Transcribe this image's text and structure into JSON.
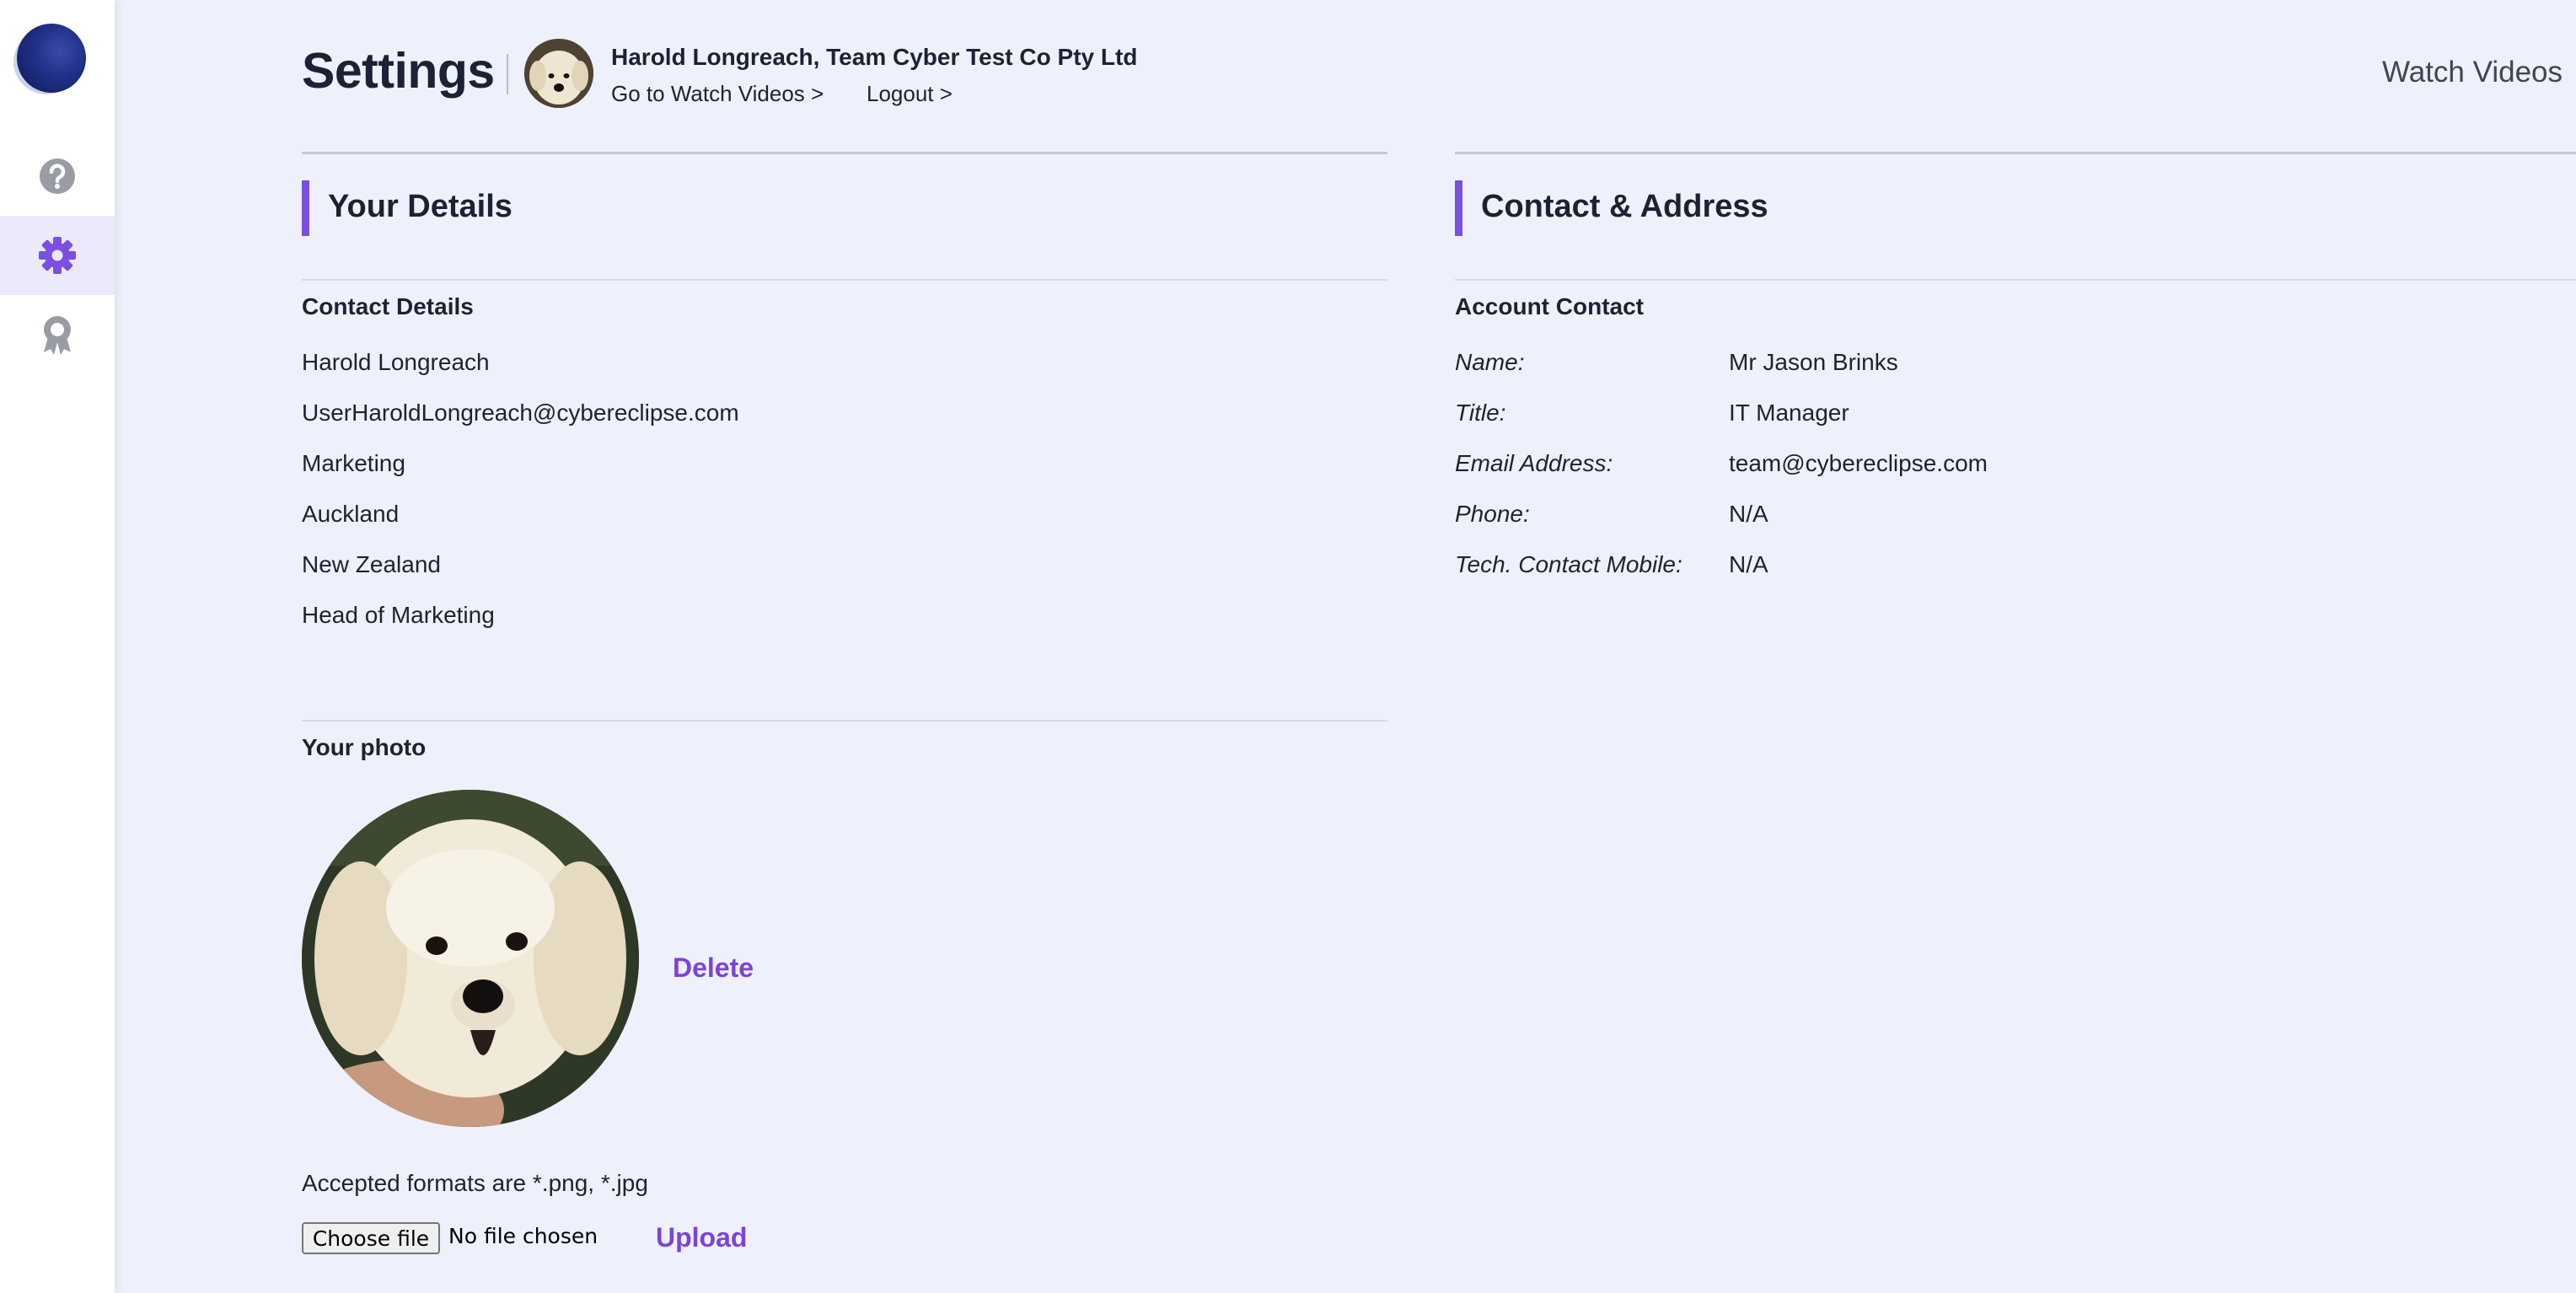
{
  "sidebar": {
    "logo_icon": "globe-logo",
    "items": [
      {
        "icon": "help-icon",
        "active": false
      },
      {
        "icon": "gear-icon",
        "active": true
      },
      {
        "icon": "award-icon",
        "active": false
      }
    ]
  },
  "header": {
    "title": "Settings",
    "user_line": "Harold Longreach, Team Cyber Test Co Pty Ltd",
    "go_to_videos": "Go to Watch Videos >",
    "logout": "Logout >",
    "watch_videos": "Watch Videos"
  },
  "your_details": {
    "title": "Your Details",
    "contact_heading": "Contact Details",
    "rows": [
      "Harold Longreach",
      "UserHaroldLongreach@cybereclipse.com",
      "Marketing",
      "Auckland",
      "New Zealand",
      "Head of Marketing"
    ],
    "photo_heading": "Your photo",
    "delete_label": "Delete",
    "formats_note": "Accepted formats are *.png, *.jpg",
    "choose_file": "Choose file",
    "no_file": "No file chosen",
    "upload_label": "Upload"
  },
  "contact_address": {
    "title": "Contact & Address",
    "heading": "Account Contact",
    "rows": [
      {
        "label": "Name:",
        "value": "Mr Jason Brinks"
      },
      {
        "label": "Title:",
        "value": "IT Manager"
      },
      {
        "label": "Email Address:",
        "value": "team@cybereclipse.com"
      },
      {
        "label": "Phone:",
        "value": "N/A"
      },
      {
        "label": "Tech. Contact Mobile:",
        "value": "N/A"
      }
    ]
  },
  "colors": {
    "accent": "#7b4fe0",
    "link": "#7b44d8",
    "background": "#eef1fb"
  }
}
